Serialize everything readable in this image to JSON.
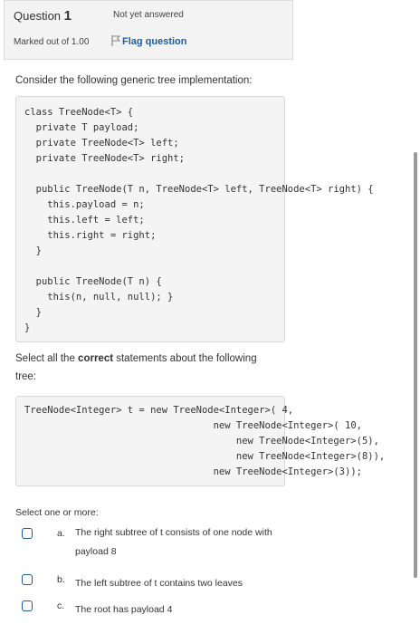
{
  "question_info": {
    "question_label": "Question",
    "question_number": "1",
    "state": "Not yet answered",
    "grade": "Marked out of 1.00",
    "flag_label": "Flag question",
    "flag_icon": "flag-icon"
  },
  "prompt": "Consider the following generic tree implementation:",
  "code_block_1": "class TreeNode<T> {\n  private T payload;\n  private TreeNode<T> left;\n  private TreeNode<T> right;\n\n  public TreeNode(T n, TreeNode<T> left, TreeNode<T> right) {\n    this.payload = n;\n    this.left = left;\n    this.right = right;\n  }\n\n  public TreeNode(T n) {\n    this(n, null, null); }\n  }\n}",
  "instruction": {
    "before": "Select all the ",
    "bold": "correct",
    "after": " statements about the following",
    "line2": "tree:"
  },
  "code_block_2": "TreeNode<Integer> t = new TreeNode<Integer>( 4,\n                                 new TreeNode<Integer>( 10,\n                                     new TreeNode<Integer>(5),\n                                     new TreeNode<Integer>(8)),\n                                 new TreeNode<Integer>(3));",
  "select_label": "Select one or more:",
  "choices": [
    {
      "letter": "a.",
      "text": "The right subtree of t consists of one node with payload 8"
    },
    {
      "letter": "b.",
      "text": "The left subtree of t contains two leaves"
    },
    {
      "letter": "c.",
      "text": "The root has payload 4"
    }
  ]
}
